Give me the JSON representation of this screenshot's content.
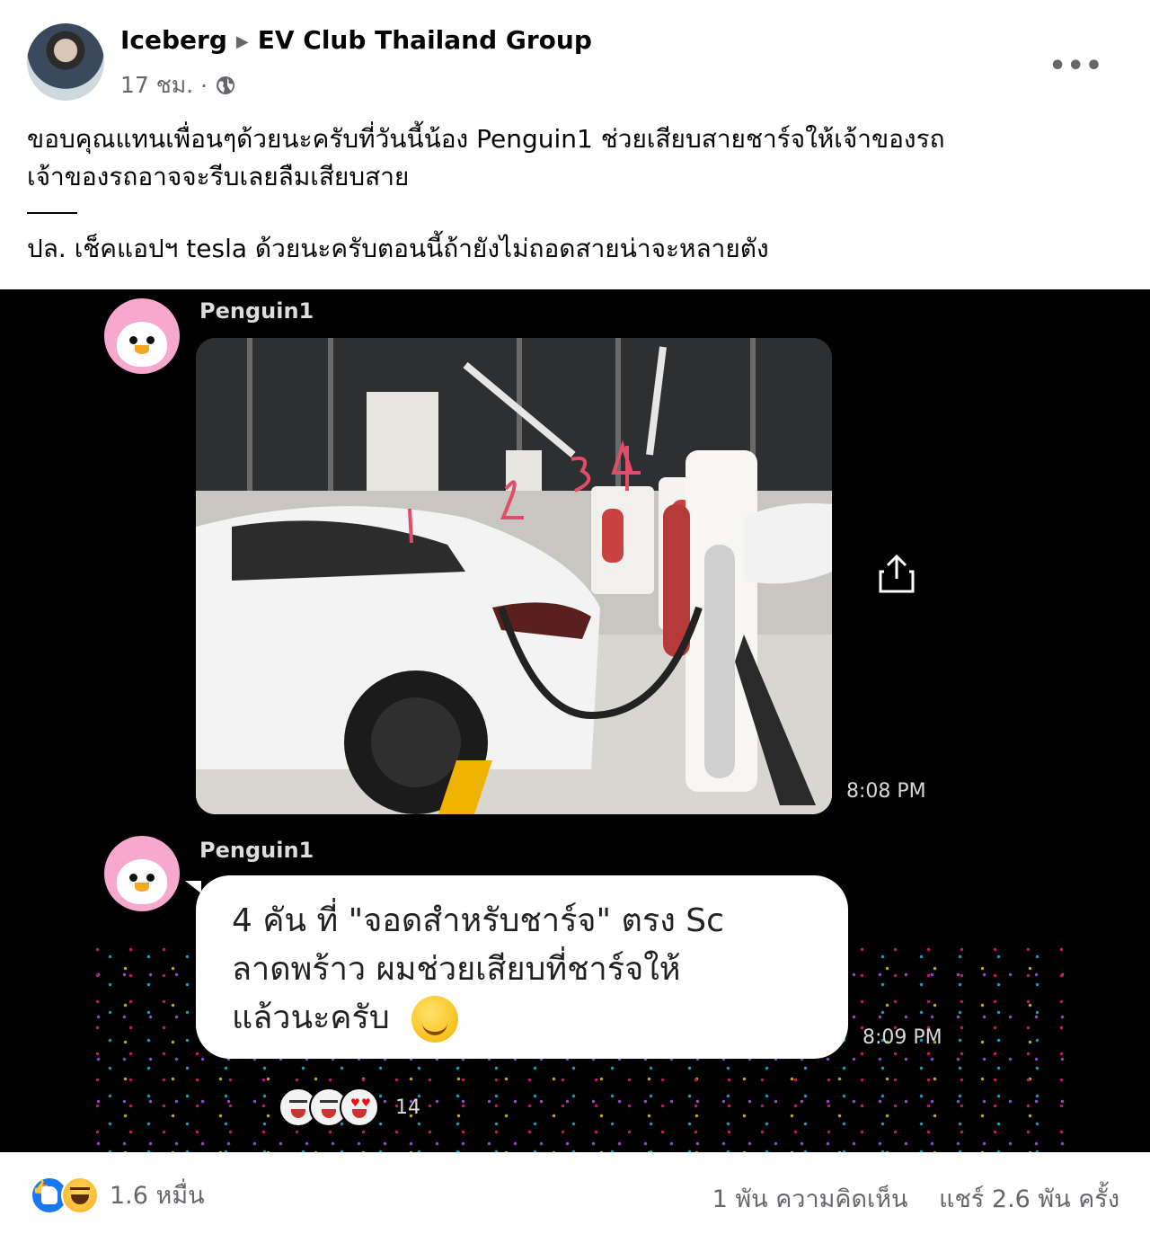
{
  "post": {
    "author": "Iceberg",
    "group": "EV Club Thailand Group",
    "time": "17 ชม.",
    "separator": "·",
    "more_label": "•••",
    "text_line1": "ขอบคุณแทนเพื่อนๆด้วยนะครับที่วันนี้น้อง Penguin1 ช่วยเสียบสายชาร์จให้เจ้าของรถ",
    "text_line2": "เจ้าของรถอาจจะรีบเลยลืมเสียบสาย",
    "text_line3": "ปล. เช็คแอปฯ tesla ด้วยนะครับตอนนี้ถ้ายังไม่ถอดสายน่าจะหลายตัง"
  },
  "chat": {
    "sender1": "Penguin1",
    "photo_time": "8:08 PM",
    "sender2": "Penguin1",
    "message_line1": "4 คัน ที่ \"จอดสำหรับชาร์จ\" ตรง Sc",
    "message_line2": "ลาดพร้าว ผมช่วยเสียบที่ชาร์จให้",
    "message_line3": "แล้วนะครับ",
    "message_time": "8:09 PM",
    "reaction_count": "14"
  },
  "footer": {
    "reactions_total": "1.6 หมื่น",
    "comments": "1 พัน ความคิดเห็น",
    "shares": "แชร์ 2.6 พัน ครั้ง"
  },
  "icons": [
    "globe-icon",
    "more-icon",
    "share-icon",
    "like-icon",
    "haha-icon",
    "hug-emoji-icon"
  ],
  "colors": {
    "like_blue": "#1877f2",
    "meta_gray": "#65676b",
    "penguin_pink": "#f7a8cf"
  }
}
